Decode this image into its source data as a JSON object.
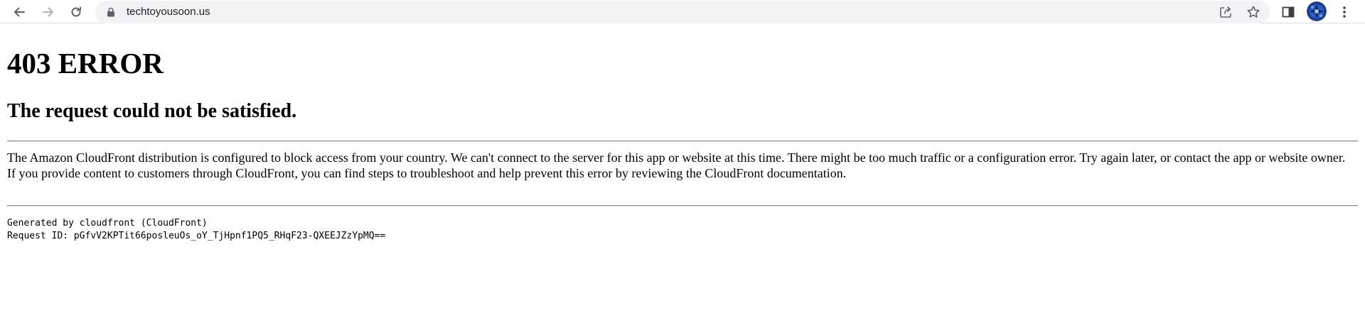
{
  "browser": {
    "url": "techtoyousoon.us",
    "icons": {
      "back": "back-arrow-icon",
      "forward": "forward-arrow-icon",
      "reload": "reload-icon",
      "lock": "lock-icon",
      "share": "share-icon",
      "bookmark": "star-icon",
      "side_panel": "side-panel-icon",
      "profile": "avatar",
      "menu": "kebab-menu-icon"
    }
  },
  "page": {
    "heading": "403 ERROR",
    "subheading": "The request could not be satisfied.",
    "paragraph1": "The Amazon CloudFront distribution is configured to block access from your country. We can't connect to the server for this app or website at this time. There might be too much traffic or a configuration error. Try again later, or contact the app or website owner.",
    "paragraph2": "If you provide content to customers through CloudFront, you can find steps to troubleshoot and help prevent this error by reviewing the CloudFront documentation.",
    "generated_by": "Generated by cloudfront (CloudFront)",
    "request_id": "Request ID: pGfvV2KPTit66posleuOs_oY_TjHpnf1PQ5_RHqF23-QXEEJZzYpMQ=="
  }
}
